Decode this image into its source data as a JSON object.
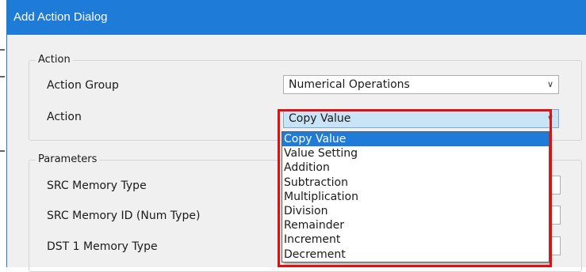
{
  "dialog": {
    "title": "Add Action Dialog"
  },
  "action_group": {
    "legend": "Action",
    "group_label": "Action Group",
    "group_value": "Numerical Operations",
    "action_label": "Action",
    "action_value": "Copy Value"
  },
  "dropdown": {
    "selected_index": 0,
    "options": [
      "Copy Value",
      "Value Setting",
      "Addition",
      "Subtraction",
      "Multiplication",
      "Division",
      "Remainder",
      "Increment",
      "Decrement"
    ]
  },
  "parameters": {
    "legend": "Parameters",
    "labels": [
      "SRC Memory Type",
      "SRC Memory ID (Num Type)",
      "DST 1 Memory Type"
    ]
  },
  "icons": {
    "chevron": "chevron-down-icon"
  },
  "colors": {
    "title_bar": "#1e7bd7",
    "selection": "#1e7bd7",
    "highlight_box": "#e01010"
  }
}
